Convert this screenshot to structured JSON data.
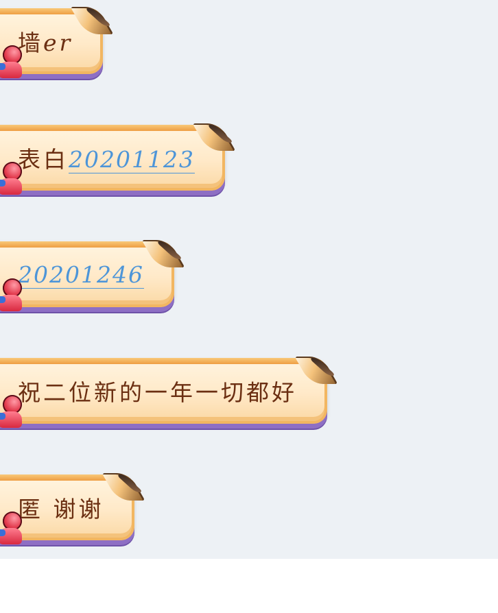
{
  "messages": [
    {
      "parts": [
        {
          "text": "墙",
          "style": "plain"
        },
        {
          "text": "er",
          "style": "latin"
        }
      ]
    },
    {
      "parts": [
        {
          "text": "表白",
          "style": "plain"
        },
        {
          "text": "20201123",
          "style": "link"
        }
      ]
    },
    {
      "parts": [
        {
          "text": "20201246",
          "style": "link"
        }
      ]
    },
    {
      "parts": [
        {
          "text": "祝二位新的一年一切都好",
          "style": "plain"
        }
      ]
    },
    {
      "parts": [
        {
          "text": "匿 谢谢",
          "style": "plain"
        }
      ]
    }
  ],
  "colors": {
    "background": "#edf1f5",
    "bubble_fill": "#ffe9c8",
    "bubble_border": "#f2b661",
    "bubble_shadow": "#8e6fc4",
    "text": "#6b2f12",
    "link": "#4d95d8"
  }
}
